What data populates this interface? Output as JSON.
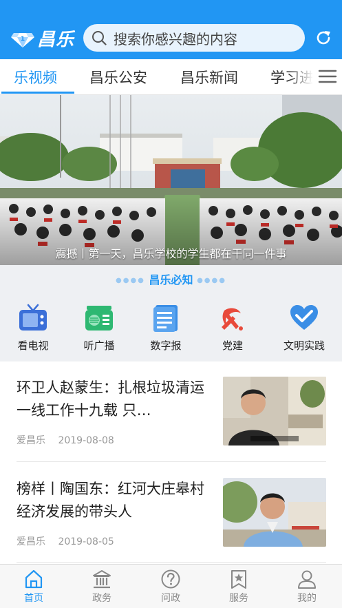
{
  "header": {
    "logo_text": "昌乐",
    "search_placeholder": "搜索你感兴趣的内容",
    "icons": [
      "diamond-logo-icon",
      "search-icon",
      "refresh-icon"
    ]
  },
  "tabs": {
    "items": [
      {
        "label": "乐视频",
        "active": true
      },
      {
        "label": "昌乐公安",
        "active": false
      },
      {
        "label": "昌乐新闻",
        "active": false
      },
      {
        "label": "学习进",
        "active": false
      }
    ],
    "menu_icon": "menu-icon"
  },
  "banner": {
    "caption": "震撼丨第一天，昌乐学校的学生都在干同一件事"
  },
  "must_know": {
    "title": "昌乐必知",
    "items": [
      {
        "label": "看电视",
        "icon": "tv-icon"
      },
      {
        "label": "听广播",
        "icon": "radio-icon"
      },
      {
        "label": "数字报",
        "icon": "newspaper-icon"
      },
      {
        "label": "党建",
        "icon": "party-emblem-icon"
      },
      {
        "label": "文明实践",
        "icon": "heart-icon"
      }
    ]
  },
  "news": [
    {
      "title": "环卫人赵蒙生：扎根垃圾清运一线工作十九载 只…",
      "source": "爱昌乐",
      "date": "2019-08-08"
    },
    {
      "title": "榜样丨陶国东：红河大庄皋村经济发展的带头人",
      "source": "爱昌乐",
      "date": "2019-08-05"
    }
  ],
  "bottom_nav": [
    {
      "label": "首页",
      "icon": "home-icon",
      "active": true
    },
    {
      "label": "政务",
      "icon": "government-icon",
      "active": false
    },
    {
      "label": "问政",
      "icon": "question-icon",
      "active": false
    },
    {
      "label": "服务",
      "icon": "service-star-icon",
      "active": false
    },
    {
      "label": "我的",
      "icon": "user-icon",
      "active": false
    }
  ],
  "colors": {
    "primary": "#2196f3",
    "tv": "#3b6fd8",
    "radio": "#2eb872",
    "newspaper": "#3a8ee6",
    "party": "#e84a3b",
    "heart": "#3a8ee6"
  }
}
